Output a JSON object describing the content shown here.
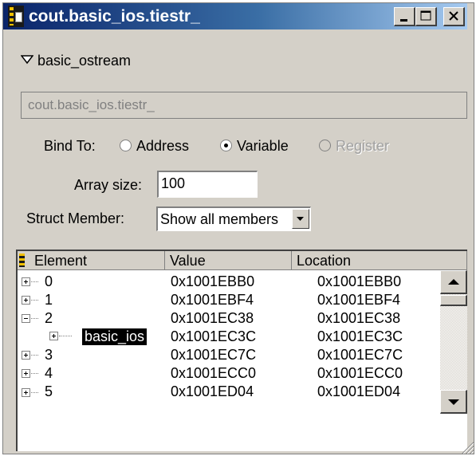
{
  "window": {
    "title": "cout.basic_ios.tiestr_"
  },
  "titlebar_buttons": {
    "minimize_icon": "minimize-icon",
    "maximize_icon": "maximize-icon",
    "close_icon": "close-icon"
  },
  "type_label": "basic_ostream",
  "expression": "cout.basic_ios.tiestr_",
  "bind": {
    "label": "Bind To:",
    "options": [
      {
        "label": "Address",
        "selected": false,
        "enabled": true
      },
      {
        "label": "Variable",
        "selected": true,
        "enabled": true
      },
      {
        "label": "Register",
        "selected": false,
        "enabled": false
      }
    ]
  },
  "array_size": {
    "label": "Array size:",
    "value": "100"
  },
  "struct_member": {
    "label": "Struct Member:",
    "value": "Show all members"
  },
  "table": {
    "columns": [
      "Element",
      "Value",
      "Location"
    ],
    "rows": [
      {
        "element": "0",
        "value": "0x1001EBB0",
        "location": "0x1001EBB0",
        "expander": "plus"
      },
      {
        "element": "1",
        "value": "0x1001EBF4",
        "location": "0x1001EBF4",
        "expander": "plus"
      },
      {
        "element": "2",
        "value": "0x1001EC38",
        "location": "0x1001EC38",
        "expander": "minus"
      },
      {
        "element": "basic_ios",
        "value": "0x1001EC3C",
        "location": "0x1001EC3C",
        "expander": "plus",
        "selected": true
      },
      {
        "element": "3",
        "value": "0x1001EC7C",
        "location": "0x1001EC7C",
        "expander": "plus"
      },
      {
        "element": "4",
        "value": "0x1001ECC0",
        "location": "0x1001ECC0",
        "expander": "plus"
      },
      {
        "element": "5",
        "value": "0x1001ED04",
        "location": "0x1001ED04",
        "expander": "plus"
      }
    ]
  },
  "colors": {
    "title_start": "#0a246a",
    "title_end": "#a6caf0",
    "face": "#d4d0c8",
    "selection": "#000000"
  }
}
